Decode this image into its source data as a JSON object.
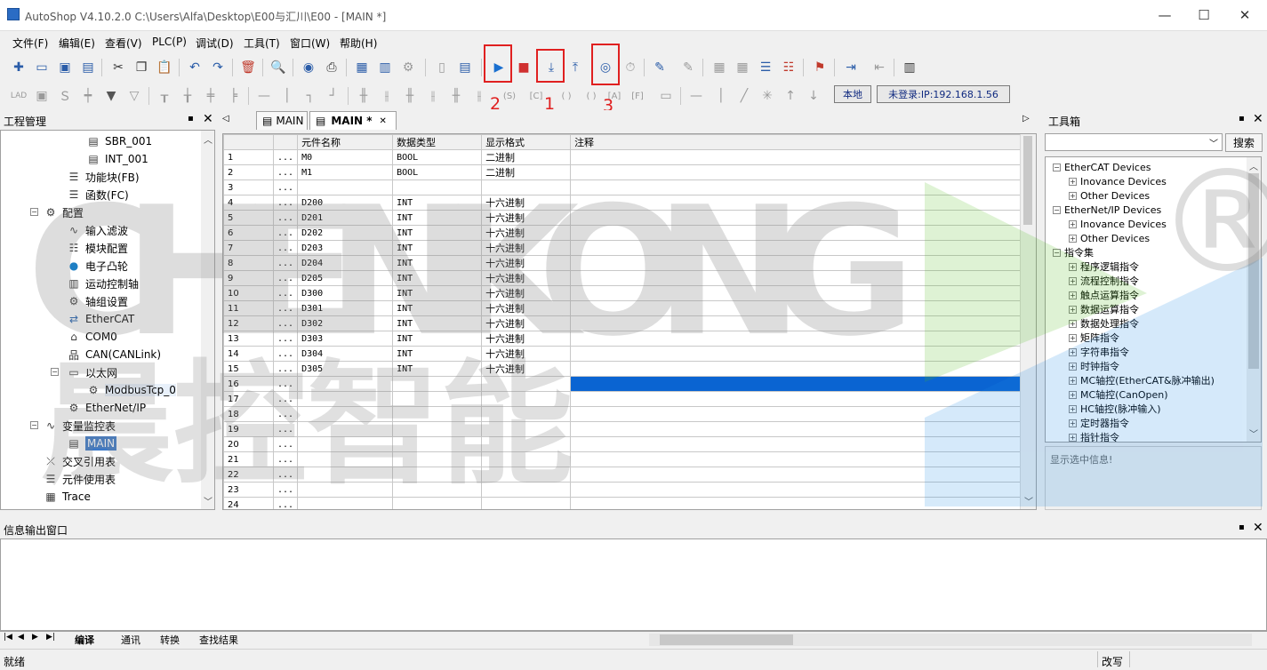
{
  "window": {
    "title": "AutoShop V4.10.2.0  C:\\Users\\Alfa\\Desktop\\E00与汇川\\E00 - [MAIN *]",
    "minimize": "—",
    "maximize": "☐",
    "close": "✕"
  },
  "menu": [
    "文件(F)",
    "编辑(E)",
    "查看(V)",
    "PLC(P)",
    "调试(D)",
    "工具(T)",
    "窗口(W)",
    "帮助(H)"
  ],
  "toolbar": {
    "annotations": [
      "2",
      "1",
      "3"
    ],
    "status_local": "本地",
    "status_login": "未登录:IP:192.168.1.56"
  },
  "project_panel": {
    "title": "工程管理",
    "pin": "▪",
    "close": "✕",
    "items": [
      {
        "label": "SBR_001",
        "icon": "doc-icon"
      },
      {
        "label": "INT_001",
        "icon": "doc-icon"
      },
      {
        "label": "功能块(FB)",
        "icon": "list-icon"
      },
      {
        "label": "函数(FC)",
        "icon": "list-icon"
      },
      {
        "label": "配置",
        "icon": "config-icon"
      },
      {
        "label": "输入滤波",
        "icon": "filter-icon"
      },
      {
        "label": "模块配置",
        "icon": "module-icon"
      },
      {
        "label": "电子凸轮",
        "icon": "cam-icon"
      },
      {
        "label": "运动控制轴",
        "icon": "axis-icon"
      },
      {
        "label": "轴组设置",
        "icon": "gear-icon"
      },
      {
        "label": "EtherCAT",
        "icon": "ethercat-icon"
      },
      {
        "label": "COM0",
        "icon": "serial-icon"
      },
      {
        "label": "CAN(CANLink)",
        "icon": "can-icon"
      },
      {
        "label": "以太网",
        "icon": "ethernet-icon"
      },
      {
        "label": "ModbusTcp_0",
        "icon": "gear-icon"
      },
      {
        "label": "EtherNet/IP",
        "icon": "config-icon"
      },
      {
        "label": "变量监控表",
        "icon": "monitor-icon"
      },
      {
        "label": "MAIN",
        "icon": "table-icon"
      },
      {
        "label": "交叉引用表",
        "icon": "crossref-icon"
      },
      {
        "label": "元件使用表",
        "icon": "db-icon"
      },
      {
        "label": "Trace",
        "icon": "trace-icon"
      }
    ]
  },
  "editor": {
    "tabs": [
      {
        "label": "MAIN",
        "active": false
      },
      {
        "label": "MAIN *",
        "active": true
      }
    ],
    "tab_close": "✕",
    "columns": [
      "",
      "",
      "元件名称",
      "数据类型",
      "显示格式",
      "注释"
    ],
    "rows": [
      {
        "n": "1",
        "dots": "...",
        "name": "M0",
        "type": "BOOL",
        "fmt": "二进制"
      },
      {
        "n": "2",
        "dots": "...",
        "name": "M1",
        "type": "BOOL",
        "fmt": "二进制"
      },
      {
        "n": "3",
        "dots": "...",
        "name": "",
        "type": "",
        "fmt": ""
      },
      {
        "n": "4",
        "dots": "...",
        "name": "D200",
        "type": "INT",
        "fmt": "十六进制"
      },
      {
        "n": "5",
        "dots": "...",
        "name": "D201",
        "type": "INT",
        "fmt": "十六进制"
      },
      {
        "n": "6",
        "dots": "...",
        "name": "D202",
        "type": "INT",
        "fmt": "十六进制"
      },
      {
        "n": "7",
        "dots": "...",
        "name": "D203",
        "type": "INT",
        "fmt": "十六进制"
      },
      {
        "n": "8",
        "dots": "...",
        "name": "D204",
        "type": "INT",
        "fmt": "十六进制"
      },
      {
        "n": "9",
        "dots": "...",
        "name": "D205",
        "type": "INT",
        "fmt": "十六进制"
      },
      {
        "n": "10",
        "dots": "...",
        "name": "D300",
        "type": "INT",
        "fmt": "十六进制"
      },
      {
        "n": "11",
        "dots": "...",
        "name": "D301",
        "type": "INT",
        "fmt": "十六进制"
      },
      {
        "n": "12",
        "dots": "...",
        "name": "D302",
        "type": "INT",
        "fmt": "十六进制"
      },
      {
        "n": "13",
        "dots": "...",
        "name": "D303",
        "type": "INT",
        "fmt": "十六进制"
      },
      {
        "n": "14",
        "dots": "...",
        "name": "D304",
        "type": "INT",
        "fmt": "十六进制"
      },
      {
        "n": "15",
        "dots": "...",
        "name": "D305",
        "type": "INT",
        "fmt": "十六进制"
      },
      {
        "n": "16",
        "dots": "...",
        "name": "",
        "type": "",
        "fmt": ""
      },
      {
        "n": "17",
        "dots": "...",
        "name": "",
        "type": "",
        "fmt": ""
      },
      {
        "n": "18",
        "dots": "...",
        "name": "",
        "type": "",
        "fmt": ""
      },
      {
        "n": "19",
        "dots": "...",
        "name": "",
        "type": "",
        "fmt": ""
      },
      {
        "n": "20",
        "dots": "...",
        "name": "",
        "type": "",
        "fmt": ""
      },
      {
        "n": "21",
        "dots": "...",
        "name": "",
        "type": "",
        "fmt": ""
      },
      {
        "n": "22",
        "dots": "...",
        "name": "",
        "type": "",
        "fmt": ""
      },
      {
        "n": "23",
        "dots": "...",
        "name": "",
        "type": "",
        "fmt": ""
      },
      {
        "n": "24",
        "dots": "...",
        "name": "",
        "type": "",
        "fmt": ""
      }
    ]
  },
  "toolbox": {
    "title": "工具箱",
    "search_button": "搜索",
    "items": [
      {
        "label": "EtherCAT Devices",
        "level": 0,
        "exp": "−"
      },
      {
        "label": "Inovance Devices",
        "level": 1,
        "exp": "+"
      },
      {
        "label": "Other Devices",
        "level": 1,
        "exp": "+"
      },
      {
        "label": "EtherNet/IP Devices",
        "level": 0,
        "exp": "−"
      },
      {
        "label": "Inovance Devices",
        "level": 1,
        "exp": "+"
      },
      {
        "label": "Other Devices",
        "level": 1,
        "exp": "+"
      },
      {
        "label": "指令集",
        "level": 0,
        "exp": "−"
      },
      {
        "label": "程序逻辑指令",
        "level": 1,
        "exp": "+"
      },
      {
        "label": "流程控制指令",
        "level": 1,
        "exp": "+"
      },
      {
        "label": "触点运算指令",
        "level": 1,
        "exp": "+"
      },
      {
        "label": "数据运算指令",
        "level": 1,
        "exp": "+"
      },
      {
        "label": "数据处理指令",
        "level": 1,
        "exp": "+"
      },
      {
        "label": "矩阵指令",
        "level": 1,
        "exp": "+"
      },
      {
        "label": "字符串指令",
        "level": 1,
        "exp": "+"
      },
      {
        "label": "时钟指令",
        "level": 1,
        "exp": "+"
      },
      {
        "label": "MC轴控(EtherCAT&脉冲输出)",
        "level": 1,
        "exp": "+"
      },
      {
        "label": "MC轴控(CanOpen)",
        "level": 1,
        "exp": "+"
      },
      {
        "label": "HC轴控(脉冲输入)",
        "level": 1,
        "exp": "+"
      },
      {
        "label": "定时器指令",
        "level": 1,
        "exp": "+"
      },
      {
        "label": "指针指令",
        "level": 1,
        "exp": "+"
      }
    ],
    "info": "显示选中信息!"
  },
  "output": {
    "title": "信息输出窗口",
    "tabs": [
      "编译",
      "通讯",
      "转换",
      "查找结果"
    ]
  },
  "statusbar": {
    "left": "就绪",
    "mode": "改写"
  },
  "watermark": {
    "latin": "CHENKONG",
    "chinese": "晨控智能",
    "mark": "®"
  },
  "colors": {
    "annotation_red": "#e02020",
    "selection_blue": "#0a64d2",
    "tree_selected": "#3b78c8"
  }
}
